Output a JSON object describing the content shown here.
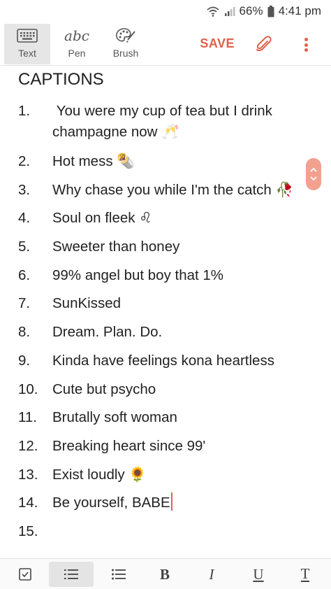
{
  "status_bar": {
    "battery_percent": "66%",
    "time": "4:41 pm"
  },
  "toolbar": {
    "tools": [
      {
        "label": "Text",
        "icon": "keyboard-icon",
        "selected": true
      },
      {
        "label": "Pen",
        "icon": "abc-handwriting-icon",
        "glyph": "abc"
      },
      {
        "label": "Brush",
        "icon": "palette-icon"
      }
    ],
    "save_label": "SAVE",
    "attach_icon": "paperclip-icon",
    "more_icon": "more-vert-icon",
    "accent_color": "#e0614a"
  },
  "note": {
    "heading": "CAPTIONS",
    "items": [
      {
        "num": "1.",
        "text": " You were my cup of tea but I drink champagne now 🥂"
      },
      {
        "num": "2.",
        "text": "Hot mess 🌯"
      },
      {
        "num": "3.",
        "text": "Why chase you while I'm the catch 🥀"
      },
      {
        "num": "4.",
        "text": "Soul on fleek ♌"
      },
      {
        "num": "5.",
        "text": "Sweeter than honey"
      },
      {
        "num": "6.",
        "text": "99% angel but boy that 1%"
      },
      {
        "num": "7.",
        "text": "SunKissed"
      },
      {
        "num": "8.",
        "text": "Dream. Plan. Do."
      },
      {
        "num": "9.",
        "text": "Kinda have feelings kona heartless"
      },
      {
        "num": "10.",
        "text": "Cute but psycho"
      },
      {
        "num": "11.",
        "text": "Brutally soft woman"
      },
      {
        "num": "12.",
        "text": "Breaking heart since 99'"
      },
      {
        "num": "13.",
        "text": "Exist loudly 🌻"
      },
      {
        "num": "14.",
        "text": "Be yourself, BABE"
      },
      {
        "num": "15.",
        "text": ""
      }
    ]
  },
  "format_bar": {
    "checkbox_icon": "checkbox-icon",
    "numbered_list_icon": "numbered-list-icon",
    "bullet_list_icon": "bullet-list-icon",
    "bold_label": "B",
    "italic_label": "I",
    "underline_label": "U",
    "text_color_label": "T"
  }
}
